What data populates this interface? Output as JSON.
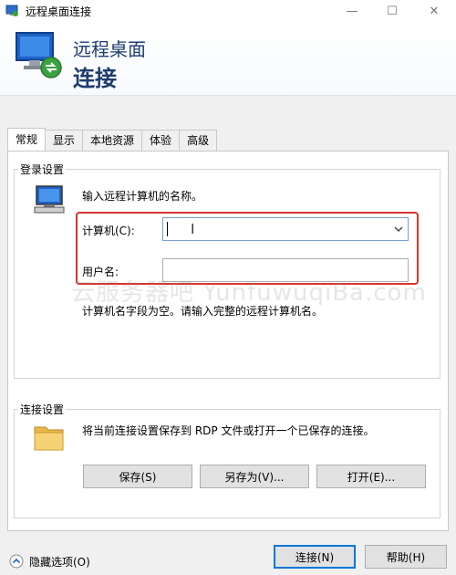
{
  "window": {
    "title": "远程桌面连接",
    "minimize_glyph": "—",
    "maximize_glyph": "☐",
    "close_glyph": "✕"
  },
  "header": {
    "line1": "远程桌面",
    "line2": "连接"
  },
  "tabs": [
    {
      "label": "常规",
      "active": true
    },
    {
      "label": "显示",
      "active": false
    },
    {
      "label": "本地资源",
      "active": false
    },
    {
      "label": "体验",
      "active": false
    },
    {
      "label": "高级",
      "active": false
    }
  ],
  "login": {
    "group_label": "登录设置",
    "instruction": "输入远程计算机的名称。",
    "computer_label": "计算机(C):",
    "computer_value": "",
    "username_label": "用户名:",
    "username_value": "",
    "error_text": "计算机名字段为空。请输入完整的远程计算机名。"
  },
  "watermark": "云服务器吧 YunfuwuqiBa.com",
  "connection": {
    "group_label": "连接设置",
    "description": "将当前连接设置保存到 RDP 文件或打开一个已保存的连接。",
    "save_label": "保存(S)",
    "save_as_label": "另存为(V)...",
    "open_label": "打开(E)..."
  },
  "footer": {
    "hide_options_label": "隐藏选项(O)",
    "connect_label": "连接(N)",
    "help_label": "帮助(H)"
  },
  "colors": {
    "highlight": "#d8342e",
    "header_text": "#1e3c6e"
  }
}
